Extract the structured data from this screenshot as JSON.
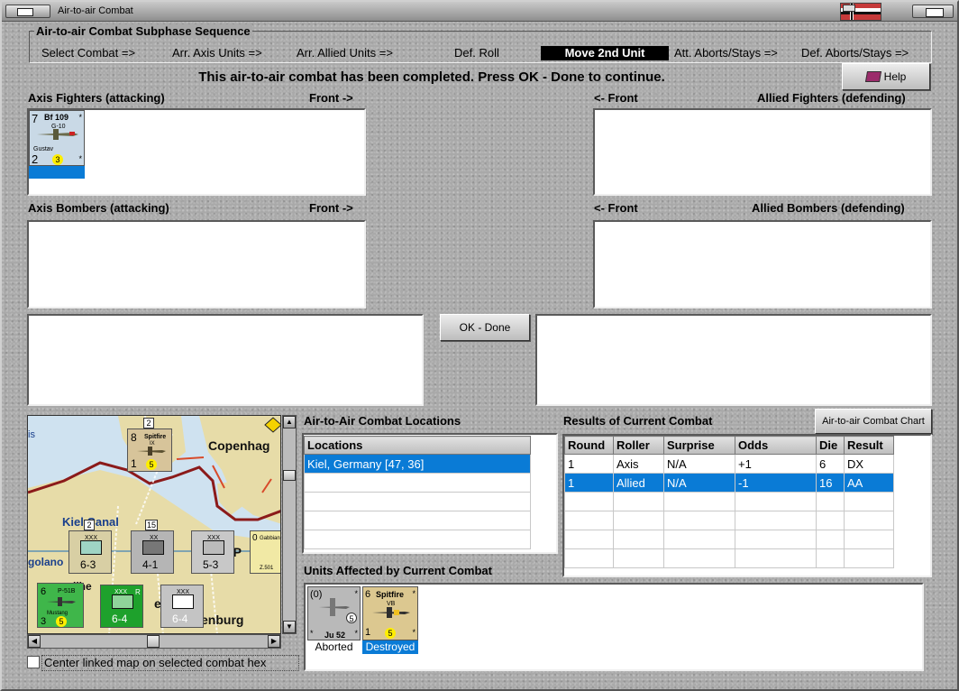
{
  "window": {
    "title": "Air-to-air Combat"
  },
  "subphase": {
    "title": "Air-to-air Combat Subphase Sequence",
    "steps": [
      "Select Combat =>",
      "Arr. Axis Units =>",
      "Arr. Allied Units =>",
      "Def. Roll",
      "Move 2nd Unit",
      "Att. Aborts/Stays =>",
      "Def. Aborts/Stays =>"
    ]
  },
  "status_message": "This air-to-air combat has been completed.  Press OK - Done to continue.",
  "help_button": "Help",
  "axis_fighters": {
    "label": "Axis Fighters (attacking)",
    "front": "Front ->"
  },
  "allied_fighters": {
    "label": "Allied Fighters (defending)",
    "front": "<- Front"
  },
  "axis_bombers": {
    "label": "Axis Bombers (attacking)",
    "front": "Front ->"
  },
  "allied_bombers": {
    "label": "Allied Bombers (defending)",
    "front": "<- Front"
  },
  "bf109_counter": {
    "attack": "7",
    "name": "Bf 109",
    "model": "G-10",
    "nickname": "Gustav",
    "defense": "2",
    "range": "3"
  },
  "ok_done_button": "OK - Done",
  "locations_panel": {
    "title": "Air-to-Air Combat Locations",
    "header": "Locations",
    "rows": [
      "Kiel, Germany [47, 36]"
    ]
  },
  "results_panel": {
    "title": "Results of Current Combat",
    "chart_button": "Air-to-air Combat Chart",
    "columns": [
      "Round",
      "Roller",
      "Surprise",
      "Odds",
      "Die",
      "Result"
    ],
    "rows": [
      [
        "1",
        "Axis",
        "N/A",
        "+1",
        "6",
        "DX"
      ],
      [
        "1",
        "Allied",
        "N/A",
        "-1",
        "16",
        "AA"
      ]
    ]
  },
  "units_affected": {
    "title": "Units Affected by Current Combat",
    "units": [
      {
        "top_left": "(0)",
        "name": "Ju 52",
        "range": "5",
        "status": "Aborted"
      },
      {
        "top_left": "6",
        "name": "Spitfire",
        "model": "VB",
        "defense": "1",
        "range": "5",
        "status": "Destroyed"
      }
    ]
  },
  "map": {
    "labels": [
      "Copenhag",
      "Kiel Canal",
      "golano",
      "k P",
      "enburg",
      "ilhe",
      "is",
      "en"
    ],
    "spitfire_counter": {
      "attack": "8",
      "name": "Spitfire",
      "model": "IX",
      "defense": "1",
      "range": "5",
      "badge": "2"
    },
    "unit_counters": [
      {
        "corps": "XXX",
        "strength": "6-3",
        "badge": "2"
      },
      {
        "corps": "XX",
        "strength": "4-1",
        "badge": "15"
      },
      {
        "corps": "XXX",
        "strength": "5-3",
        "badge": ""
      },
      {
        "corps": "XXX",
        "strength": "6-4",
        "badge": "R"
      },
      {
        "corps": "XXX",
        "strength": "6-4",
        "badge": ""
      }
    ],
    "p51_counter": {
      "attack": "6",
      "name": "P-51B",
      "nickname": "Mustang",
      "defense": "3",
      "range": "5"
    },
    "gabbiano_label": "Gabbiani",
    "gabbiano_number": "Z.501",
    "gabbiano_attack": "0"
  },
  "center_map_checkbox": {
    "label": "Center linked map on selected combat hex",
    "checked": false
  },
  "colors": {
    "selection": "#0a7bd6",
    "active_step_bg": "#000000",
    "map_sea": "#cfe2f0",
    "map_land": "#e7dca8",
    "border_line": "#8b1a1a"
  }
}
